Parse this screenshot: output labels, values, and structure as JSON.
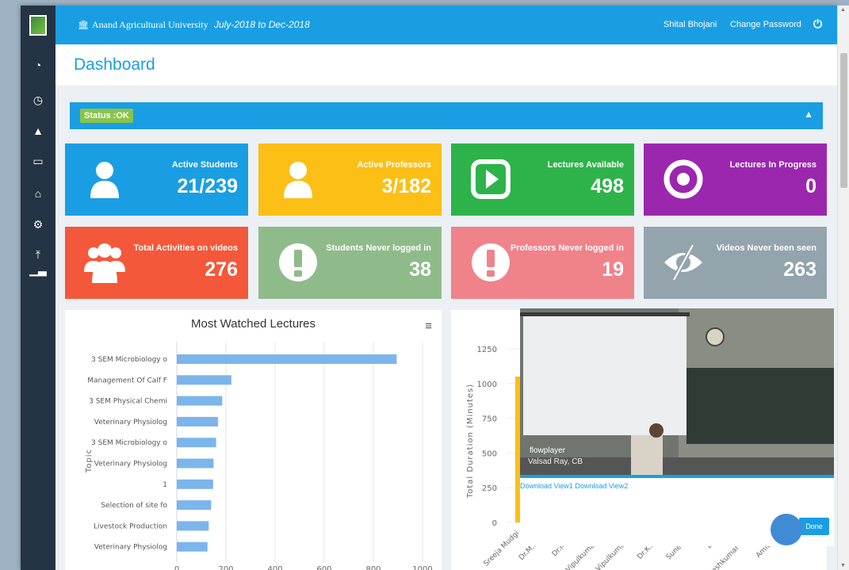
{
  "topbar": {
    "university": "Anand Agricultural University",
    "session": "July-2018 to Dec-2018",
    "user": "Shital Bhojani",
    "change_password": "Change Password",
    "power_icon": "power-icon"
  },
  "sidebar": {
    "icons": [
      "dashboard-icon",
      "clock-icon",
      "user-icon",
      "monitor-icon",
      "university-icon",
      "gear-icon",
      "upload-icon",
      "bar-chart-icon"
    ]
  },
  "page": {
    "title": "Dashboard"
  },
  "status": {
    "badge": "Status :OK"
  },
  "cards": [
    {
      "label": "Active Students",
      "value": "21/239",
      "color": "#1a9ee3",
      "icon": "user-icon"
    },
    {
      "label": "Active Professors",
      "value": "3/182",
      "color": "#fbbf16",
      "icon": "user-icon"
    },
    {
      "label": "Lectures Available",
      "value": "498",
      "color": "#2db34a",
      "icon": "play-icon"
    },
    {
      "label": "Lectures In Progress",
      "value": "0",
      "color": "#9b27af",
      "icon": "target-icon"
    },
    {
      "label": "Total Activities on videos",
      "value": "276",
      "color": "#f4583a",
      "icon": "users-icon"
    },
    {
      "label": "Students Never logged in",
      "value": "38",
      "color": "#8fbb8a",
      "icon": "exclamation-icon"
    },
    {
      "label": "Professors Never logged in",
      "value": "19",
      "color": "#f0828a",
      "icon": "exclamation-icon"
    },
    {
      "label": "Videos Never been seen",
      "value": "263",
      "color": "#93a4ad",
      "icon": "eye-slash-icon"
    }
  ],
  "chart_data": [
    {
      "type": "bar",
      "orientation": "horizontal",
      "title": "Most Watched Lectures",
      "ylabel": "Topic",
      "xlabel": "",
      "categories": [
        "3 SEM Microbiology o",
        "Management Of Calf F",
        "3 SEM Physical Chemi",
        "Veterinary Physiolog",
        "3 SEM Microbiology o",
        "Veterinary Physiolog",
        "1",
        "Selection of site fo",
        "Livestock Production",
        "Veterinary Physiolog"
      ],
      "values": [
        895,
        222,
        185,
        168,
        160,
        150,
        148,
        140,
        130,
        125
      ],
      "xlim": [
        0,
        1000
      ],
      "xticks": [
        0,
        200,
        400,
        600,
        800,
        1000
      ],
      "bar_color": "#7cb5ec",
      "grid": true
    },
    {
      "type": "bar",
      "title": "",
      "ylabel": "Total Duration (Minutes)",
      "ylim": [
        0,
        1250
      ],
      "yticks": [
        0,
        250,
        500,
        750,
        1000,
        1250
      ],
      "categories": [
        "Sreeja Mudgi",
        "Dr.M.M.Pat",
        "Dr.M.M.Is",
        "Vipulkumar D.T",
        "Vipulkumar Pat",
        "Dr.K.M.Pat",
        "Suneeta P.",
        "Dr.R.J.",
        "Kalpeshkumar Chau",
        "Amit Kum"
      ],
      "values": [
        1050
      ],
      "bar_color": "#fbbf16"
    }
  ],
  "video": {
    "watermark": "flowplayer",
    "caption": "Valsad Ray, CB",
    "links": "Download View1 Download View2",
    "done": "Done"
  }
}
